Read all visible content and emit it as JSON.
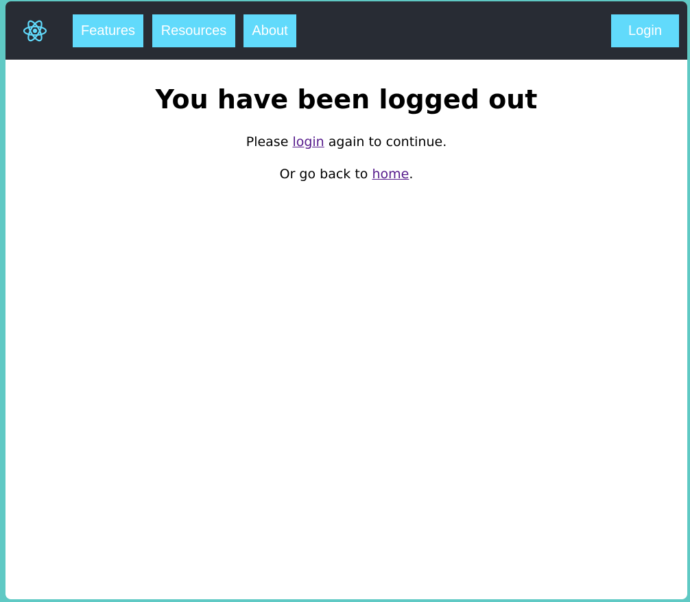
{
  "nav": {
    "logo_icon": "react-atom-icon",
    "items": [
      {
        "label": "Features"
      },
      {
        "label": "Resources"
      },
      {
        "label": "About"
      }
    ],
    "login_label": "Login"
  },
  "main": {
    "title": "You have been logged out",
    "line1": {
      "prefix": "Please ",
      "link_text": "login",
      "suffix": " again to continue."
    },
    "line2": {
      "prefix": "Or go back to ",
      "link_text": "home",
      "suffix": "."
    }
  },
  "colors": {
    "navbar_bg": "#282c34",
    "accent": "#61dafb",
    "link_visited": "#551a8b"
  }
}
